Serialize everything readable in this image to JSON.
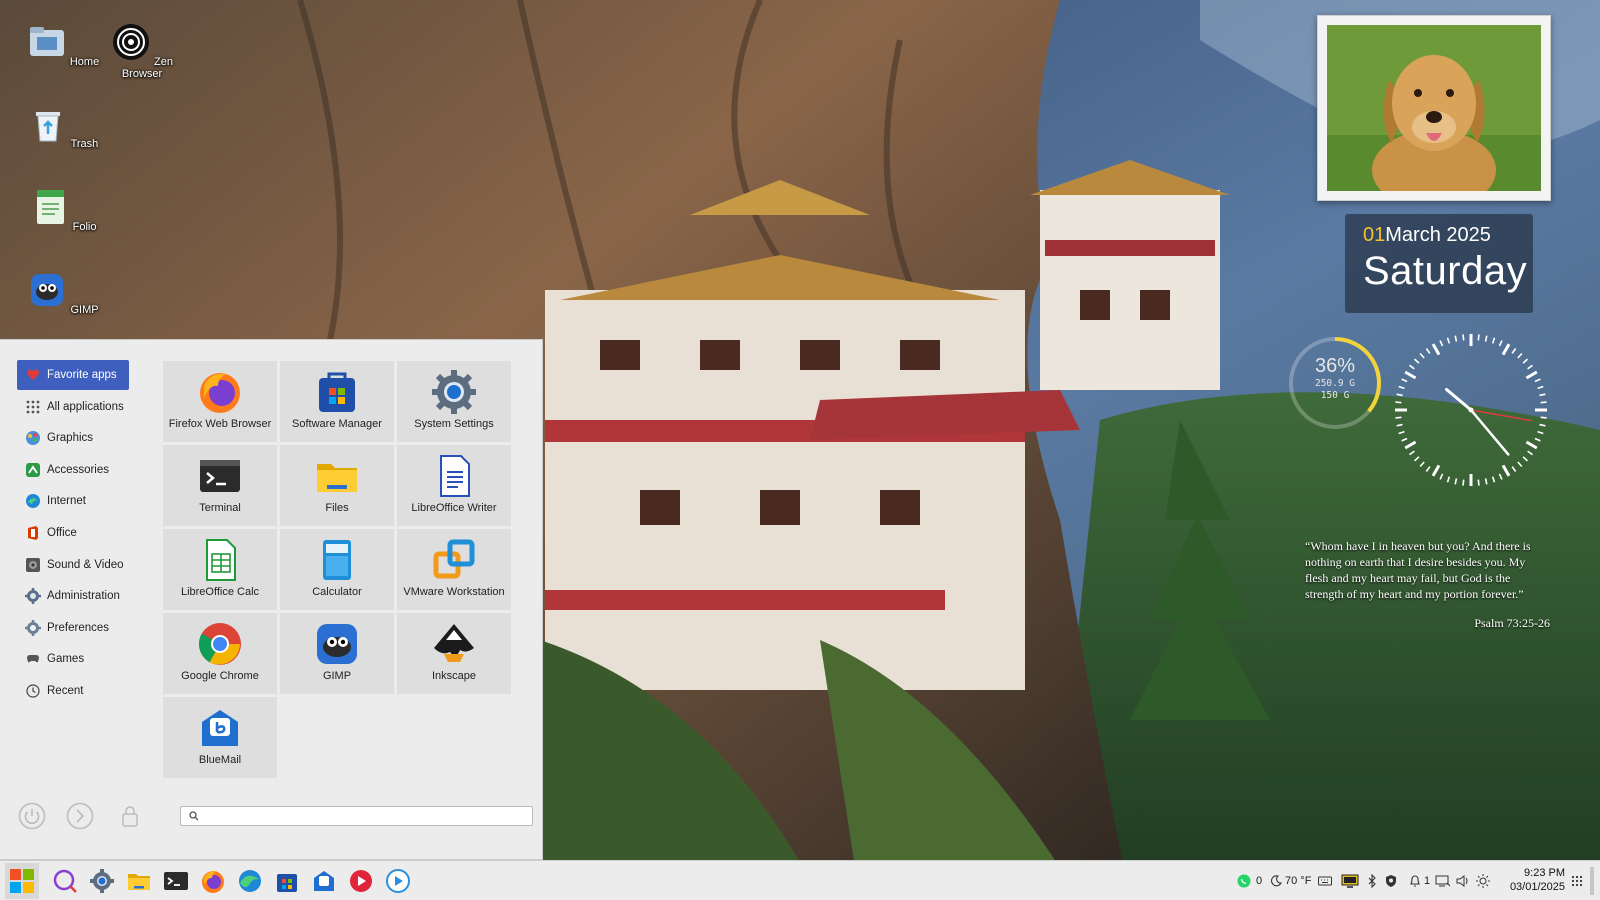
{
  "desktop": {
    "icons": [
      {
        "label": "Home",
        "icon": "home-folder-icon"
      },
      {
        "label": "Zen Browser",
        "icon": "zen-browser-icon"
      },
      {
        "label": "Trash",
        "icon": "trash-icon"
      },
      {
        "label": "Folio",
        "icon": "folio-notes-icon"
      },
      {
        "label": "GIMP",
        "icon": "gimp-icon"
      }
    ]
  },
  "widgets": {
    "date": {
      "day": "01",
      "month_year": "March 2025",
      "weekday": "Saturday"
    },
    "disk": {
      "percent": "36%",
      "total": "250.9 G",
      "used": "150 G",
      "fill_fraction": 0.36,
      "accent": "#f2d33a"
    },
    "clock": {
      "hour_angle_deg": 310,
      "minute_angle_deg": 140,
      "second_angle_deg": 100,
      "second_hand_color": "#e03a3a"
    },
    "quote": {
      "text": "“Whom have I in heaven but you? And there is nothing on earth that I desire besides you. My flesh and my heart may fail, but God is the strength of my heart and my portion forever.”",
      "reference": "Psalm 73:25-26"
    }
  },
  "start_menu": {
    "categories": [
      {
        "label": "Favorite apps",
        "icon": "heart-icon",
        "active": true
      },
      {
        "label": "All applications",
        "icon": "grid-icon",
        "active": false
      },
      {
        "label": "Graphics",
        "icon": "graphics-icon",
        "active": false
      },
      {
        "label": "Accessories",
        "icon": "accessories-icon",
        "active": false
      },
      {
        "label": "Internet",
        "icon": "internet-icon",
        "active": false
      },
      {
        "label": "Office",
        "icon": "office-icon",
        "active": false
      },
      {
        "label": "Sound & Video",
        "icon": "sound-video-icon",
        "active": false
      },
      {
        "label": "Administration",
        "icon": "administration-icon",
        "active": false
      },
      {
        "label": "Preferences",
        "icon": "preferences-icon",
        "active": false
      },
      {
        "label": "Games",
        "icon": "games-icon",
        "active": false
      },
      {
        "label": "Recent",
        "icon": "recent-icon",
        "active": false
      }
    ],
    "apps": [
      {
        "label": "Firefox Web Browser",
        "icon": "firefox-icon"
      },
      {
        "label": "Software Manager",
        "icon": "software-manager-icon"
      },
      {
        "label": "System Settings",
        "icon": "system-settings-icon"
      },
      {
        "label": "Terminal",
        "icon": "terminal-icon"
      },
      {
        "label": "Files",
        "icon": "files-icon"
      },
      {
        "label": "LibreOffice Writer",
        "icon": "libreoffice-writer-icon"
      },
      {
        "label": "LibreOffice Calc",
        "icon": "libreoffice-calc-icon"
      },
      {
        "label": "Calculator",
        "icon": "calculator-icon"
      },
      {
        "label": "VMware Workstation",
        "icon": "vmware-icon"
      },
      {
        "label": "Google Chrome",
        "icon": "chrome-icon"
      },
      {
        "label": "GIMP",
        "icon": "gimp-icon"
      },
      {
        "label": "Inkscape",
        "icon": "inkscape-icon"
      },
      {
        "label": "BlueMail",
        "icon": "bluemail-icon"
      }
    ],
    "search": {
      "placeholder": "",
      "value": ""
    },
    "bottom_buttons": [
      "power-icon",
      "logout-icon",
      "lock-icon"
    ]
  },
  "taskbar": {
    "pinned": [
      "start-menu-icon",
      "search-icon",
      "settings-icon",
      "files-icon",
      "terminal-icon",
      "firefox-icon",
      "edge-icon",
      "software-manager-icon",
      "bluemail-icon",
      "media-player-icon",
      "video-player-icon"
    ],
    "tray": {
      "whatsapp_count": "0",
      "weather": "70 °F",
      "notifications_count": "1",
      "time": "9:23 PM",
      "date": "03/01/2025"
    }
  },
  "colors": {
    "menu_bg": "#ececec",
    "tile_bg": "#dedede",
    "active_category": "#3f5fbf",
    "date_accent": "#f2c230"
  }
}
